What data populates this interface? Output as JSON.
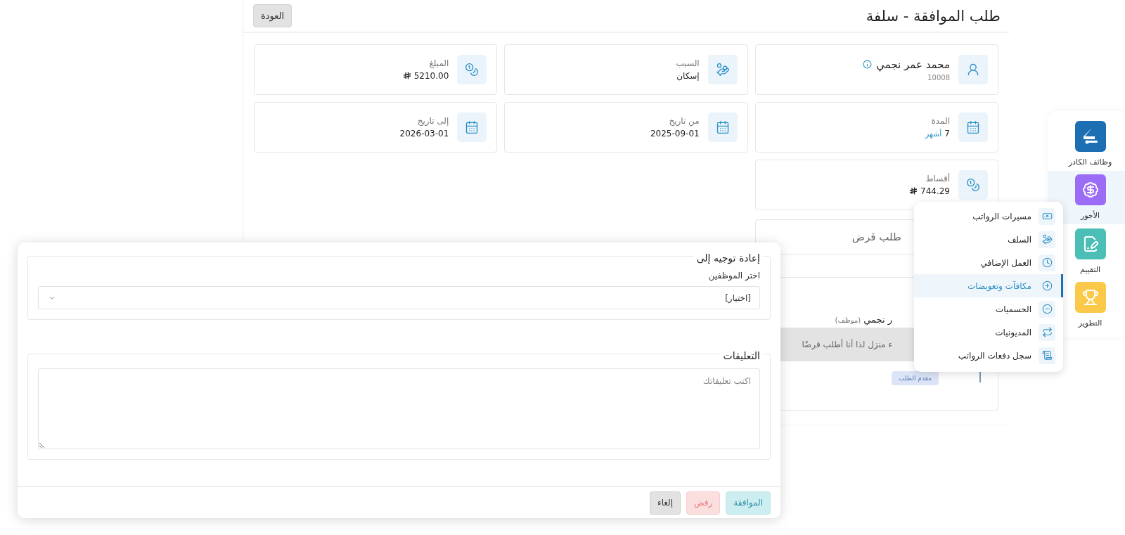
{
  "page": {
    "title": "طلب الموافقة - سلفة",
    "back_button": "العودة"
  },
  "info_cards": [
    {
      "kind": "person",
      "name": "محمد عمر نجمي",
      "number": "10008"
    },
    {
      "kind": "reason",
      "label": "السبب",
      "value": "إسكان"
    },
    {
      "kind": "money",
      "label": "المبلغ",
      "value": "5210.00"
    },
    {
      "kind": "duration",
      "label": "المدة",
      "value": "7",
      "unit": "أشهر"
    },
    {
      "kind": "date",
      "label": "من تاريخ",
      "value": "2025-09-01"
    },
    {
      "kind": "date",
      "label": "إلى تاريخ",
      "value": "2026-03-01"
    },
    {
      "kind": "money",
      "label": "أقساط",
      "value": "744.29"
    }
  ],
  "loan_request": {
    "title": "طلب قرض"
  },
  "timeline": {
    "name": "ر نجمي",
    "role": "(موظف)",
    "note": "ء منزل لذا أنا أطلب قرضًا",
    "badge": "مقدم الطلب"
  },
  "rail": {
    "items": [
      {
        "label": "وظائف الكادر",
        "color": "#1d6fb3",
        "selected": false
      },
      {
        "label": "الأجور",
        "color": "#9b6cf6",
        "selected": true
      },
      {
        "label": "التقييم",
        "color": "#4bbfb5",
        "selected": false
      },
      {
        "label": "التطوير",
        "color": "#fbc94a",
        "selected": false
      }
    ]
  },
  "menu": {
    "items": [
      {
        "label": "مسيرات الرواتب",
        "selected": false
      },
      {
        "label": "السلف",
        "selected": false
      },
      {
        "label": "العمل الإضافي",
        "selected": false
      },
      {
        "label": "مكافآت وتعويضات",
        "selected": true
      },
      {
        "label": "الحسميات",
        "selected": false
      },
      {
        "label": "المديونيات",
        "selected": false
      },
      {
        "label": "سجل دفعات الرواتب",
        "selected": false
      }
    ]
  },
  "dialog": {
    "redirect": {
      "title": "إعادة توجيه إلى",
      "label": "اختر الموظفين",
      "select": {
        "value": "[اختيار]"
      }
    },
    "comments": {
      "title": "التعليقات",
      "placeholder": "اكتب تعليقاتك"
    },
    "buttons": [
      {
        "label": "الموافقة",
        "kind": "approve"
      },
      {
        "label": "رفض",
        "kind": "reject"
      },
      {
        "label": "إلغاء",
        "kind": "cancel"
      }
    ]
  }
}
